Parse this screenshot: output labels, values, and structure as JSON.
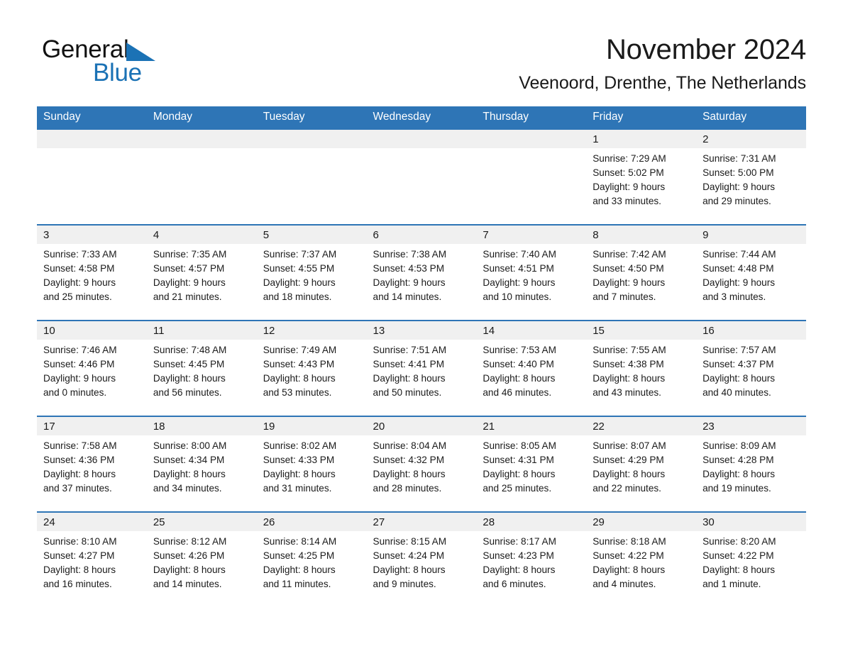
{
  "logo": {
    "word1": "General",
    "word2": "Blue",
    "triangle_color": "#1b72b5",
    "icon": "triangle-icon"
  },
  "header": {
    "title": "November 2024",
    "subtitle": "Veenoord, Drenthe, The Netherlands"
  },
  "theme": {
    "header_bg": "#2e75b6",
    "header_text": "#ffffff",
    "daynum_band_bg": "#f0f0f0",
    "row_divider": "#2e75b6",
    "body_text": "#1a1a1a"
  },
  "calendar": {
    "weekday_headers": [
      "Sunday",
      "Monday",
      "Tuesday",
      "Wednesday",
      "Thursday",
      "Friday",
      "Saturday"
    ],
    "weeks": [
      [
        {
          "day": "",
          "lines": []
        },
        {
          "day": "",
          "lines": []
        },
        {
          "day": "",
          "lines": []
        },
        {
          "day": "",
          "lines": []
        },
        {
          "day": "",
          "lines": []
        },
        {
          "day": "1",
          "lines": [
            "Sunrise: 7:29 AM",
            "Sunset: 5:02 PM",
            "Daylight: 9 hours",
            "and 33 minutes."
          ]
        },
        {
          "day": "2",
          "lines": [
            "Sunrise: 7:31 AM",
            "Sunset: 5:00 PM",
            "Daylight: 9 hours",
            "and 29 minutes."
          ]
        }
      ],
      [
        {
          "day": "3",
          "lines": [
            "Sunrise: 7:33 AM",
            "Sunset: 4:58 PM",
            "Daylight: 9 hours",
            "and 25 minutes."
          ]
        },
        {
          "day": "4",
          "lines": [
            "Sunrise: 7:35 AM",
            "Sunset: 4:57 PM",
            "Daylight: 9 hours",
            "and 21 minutes."
          ]
        },
        {
          "day": "5",
          "lines": [
            "Sunrise: 7:37 AM",
            "Sunset: 4:55 PM",
            "Daylight: 9 hours",
            "and 18 minutes."
          ]
        },
        {
          "day": "6",
          "lines": [
            "Sunrise: 7:38 AM",
            "Sunset: 4:53 PM",
            "Daylight: 9 hours",
            "and 14 minutes."
          ]
        },
        {
          "day": "7",
          "lines": [
            "Sunrise: 7:40 AM",
            "Sunset: 4:51 PM",
            "Daylight: 9 hours",
            "and 10 minutes."
          ]
        },
        {
          "day": "8",
          "lines": [
            "Sunrise: 7:42 AM",
            "Sunset: 4:50 PM",
            "Daylight: 9 hours",
            "and 7 minutes."
          ]
        },
        {
          "day": "9",
          "lines": [
            "Sunrise: 7:44 AM",
            "Sunset: 4:48 PM",
            "Daylight: 9 hours",
            "and 3 minutes."
          ]
        }
      ],
      [
        {
          "day": "10",
          "lines": [
            "Sunrise: 7:46 AM",
            "Sunset: 4:46 PM",
            "Daylight: 9 hours",
            "and 0 minutes."
          ]
        },
        {
          "day": "11",
          "lines": [
            "Sunrise: 7:48 AM",
            "Sunset: 4:45 PM",
            "Daylight: 8 hours",
            "and 56 minutes."
          ]
        },
        {
          "day": "12",
          "lines": [
            "Sunrise: 7:49 AM",
            "Sunset: 4:43 PM",
            "Daylight: 8 hours",
            "and 53 minutes."
          ]
        },
        {
          "day": "13",
          "lines": [
            "Sunrise: 7:51 AM",
            "Sunset: 4:41 PM",
            "Daylight: 8 hours",
            "and 50 minutes."
          ]
        },
        {
          "day": "14",
          "lines": [
            "Sunrise: 7:53 AM",
            "Sunset: 4:40 PM",
            "Daylight: 8 hours",
            "and 46 minutes."
          ]
        },
        {
          "day": "15",
          "lines": [
            "Sunrise: 7:55 AM",
            "Sunset: 4:38 PM",
            "Daylight: 8 hours",
            "and 43 minutes."
          ]
        },
        {
          "day": "16",
          "lines": [
            "Sunrise: 7:57 AM",
            "Sunset: 4:37 PM",
            "Daylight: 8 hours",
            "and 40 minutes."
          ]
        }
      ],
      [
        {
          "day": "17",
          "lines": [
            "Sunrise: 7:58 AM",
            "Sunset: 4:36 PM",
            "Daylight: 8 hours",
            "and 37 minutes."
          ]
        },
        {
          "day": "18",
          "lines": [
            "Sunrise: 8:00 AM",
            "Sunset: 4:34 PM",
            "Daylight: 8 hours",
            "and 34 minutes."
          ]
        },
        {
          "day": "19",
          "lines": [
            "Sunrise: 8:02 AM",
            "Sunset: 4:33 PM",
            "Daylight: 8 hours",
            "and 31 minutes."
          ]
        },
        {
          "day": "20",
          "lines": [
            "Sunrise: 8:04 AM",
            "Sunset: 4:32 PM",
            "Daylight: 8 hours",
            "and 28 minutes."
          ]
        },
        {
          "day": "21",
          "lines": [
            "Sunrise: 8:05 AM",
            "Sunset: 4:31 PM",
            "Daylight: 8 hours",
            "and 25 minutes."
          ]
        },
        {
          "day": "22",
          "lines": [
            "Sunrise: 8:07 AM",
            "Sunset: 4:29 PM",
            "Daylight: 8 hours",
            "and 22 minutes."
          ]
        },
        {
          "day": "23",
          "lines": [
            "Sunrise: 8:09 AM",
            "Sunset: 4:28 PM",
            "Daylight: 8 hours",
            "and 19 minutes."
          ]
        }
      ],
      [
        {
          "day": "24",
          "lines": [
            "Sunrise: 8:10 AM",
            "Sunset: 4:27 PM",
            "Daylight: 8 hours",
            "and 16 minutes."
          ]
        },
        {
          "day": "25",
          "lines": [
            "Sunrise: 8:12 AM",
            "Sunset: 4:26 PM",
            "Daylight: 8 hours",
            "and 14 minutes."
          ]
        },
        {
          "day": "26",
          "lines": [
            "Sunrise: 8:14 AM",
            "Sunset: 4:25 PM",
            "Daylight: 8 hours",
            "and 11 minutes."
          ]
        },
        {
          "day": "27",
          "lines": [
            "Sunrise: 8:15 AM",
            "Sunset: 4:24 PM",
            "Daylight: 8 hours",
            "and 9 minutes."
          ]
        },
        {
          "day": "28",
          "lines": [
            "Sunrise: 8:17 AM",
            "Sunset: 4:23 PM",
            "Daylight: 8 hours",
            "and 6 minutes."
          ]
        },
        {
          "day": "29",
          "lines": [
            "Sunrise: 8:18 AM",
            "Sunset: 4:22 PM",
            "Daylight: 8 hours",
            "and 4 minutes."
          ]
        },
        {
          "day": "30",
          "lines": [
            "Sunrise: 8:20 AM",
            "Sunset: 4:22 PM",
            "Daylight: 8 hours",
            "and 1 minute."
          ]
        }
      ]
    ]
  }
}
